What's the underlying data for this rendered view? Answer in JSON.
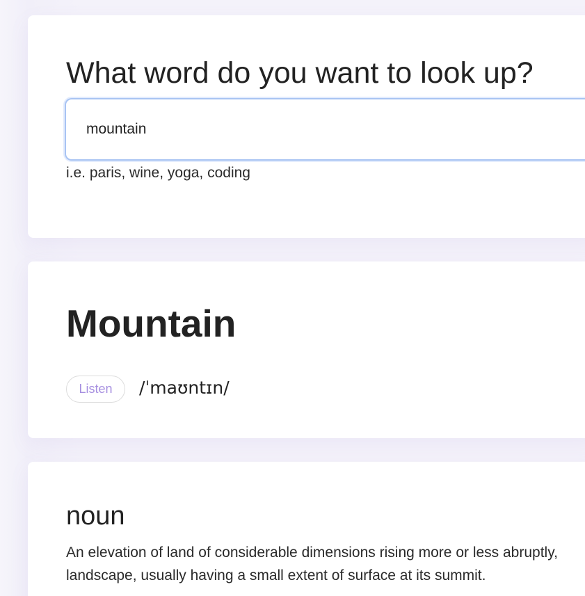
{
  "search": {
    "title": "What word do you want to look up?",
    "value": "mountain",
    "hint": "i.e. paris, wine, yoga, coding"
  },
  "entry": {
    "word": "Mountain",
    "listen_label": "Listen",
    "phonetic": "/ˈmaʊntɪn/"
  },
  "meaning": {
    "part_of_speech": "noun",
    "definition_line1": "An elevation of land of considerable dimensions rising more or less abruptly,",
    "definition_line2": "landscape, usually having a small extent of surface at its summit."
  },
  "colors": {
    "accent": "#a68fe0",
    "input_focus_border": "#a9c4f3",
    "background": "#f5f3fb"
  }
}
